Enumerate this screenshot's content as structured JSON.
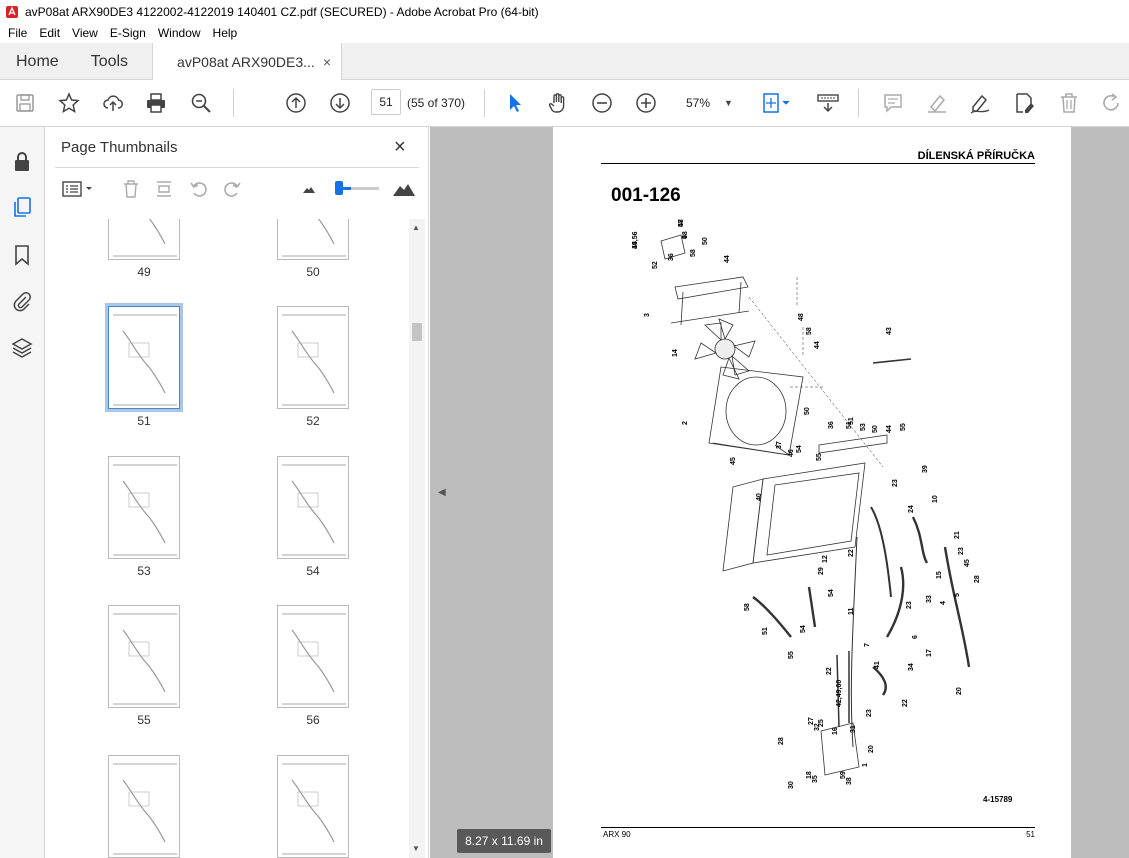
{
  "window": {
    "title": "avP08at ARX90DE3 4122002-4122019 140401 CZ.pdf (SECURED) - Adobe Acrobat Pro (64-bit)"
  },
  "menu": [
    "File",
    "Edit",
    "View",
    "E-Sign",
    "Window",
    "Help"
  ],
  "tabs": {
    "home": "Home",
    "tools": "Tools",
    "document": "avP08at ARX90DE3...",
    "close": "×"
  },
  "toolbar": {
    "current_page": "51",
    "page_count": "(55 of 370)",
    "zoom": "57%",
    "icons": [
      "save-icon",
      "star-icon",
      "upload-icon",
      "print-icon",
      "zoom-search-icon",
      "page-up-icon",
      "page-down-icon",
      "select-cursor-icon",
      "hand-icon",
      "zoom-out-icon",
      "zoom-in-icon",
      "fit-page-icon",
      "scroll-mode-icon",
      "comment-icon",
      "highlight-icon",
      "sign-icon",
      "edit-doc-icon",
      "delete-icon",
      "redo-icon"
    ]
  },
  "thumbnails_panel": {
    "title": "Page Thumbnails",
    "close": "×",
    "thumb_size_fraction": 0.25,
    "pages": [
      {
        "label": "49"
      },
      {
        "label": "50"
      },
      {
        "label": "51",
        "selected": true
      },
      {
        "label": "52"
      },
      {
        "label": "53"
      },
      {
        "label": "54"
      },
      {
        "label": "55"
      },
      {
        "label": "56"
      },
      {
        "label": ""
      },
      {
        "label": ""
      }
    ]
  },
  "document_page": {
    "header": "DÍLENSKÁ PŘÍRUČKA",
    "title": "001-126",
    "figure_number": "4-15789",
    "footer_left": "ARX 90",
    "footer_right": "51",
    "callouts": [
      "19,56",
      "47",
      "9",
      "36",
      "52",
      "50",
      "58",
      "44",
      "3",
      "48",
      "58",
      "44",
      "43",
      "14",
      "51",
      "50",
      "2",
      "36",
      "51",
      "53",
      "50",
      "44",
      "55",
      "45",
      "37",
      "46",
      "54",
      "55",
      "40",
      "39",
      "23",
      "10",
      "24",
      "29",
      "12",
      "22",
      "21",
      "23",
      "45",
      "58",
      "54",
      "15",
      "28",
      "5",
      "11",
      "23",
      "33",
      "4",
      "51",
      "55",
      "54",
      "6",
      "17",
      "22",
      "42,49,60",
      "7",
      "41",
      "34",
      "20",
      "22",
      "16",
      "25",
      "23",
      "32",
      "28",
      "20",
      "27",
      "30",
      "35",
      "31",
      "18",
      "59",
      "38",
      "1",
      "44",
      "58",
      "48"
    ]
  },
  "page_size_label": "8.27 x 11.69 in"
}
